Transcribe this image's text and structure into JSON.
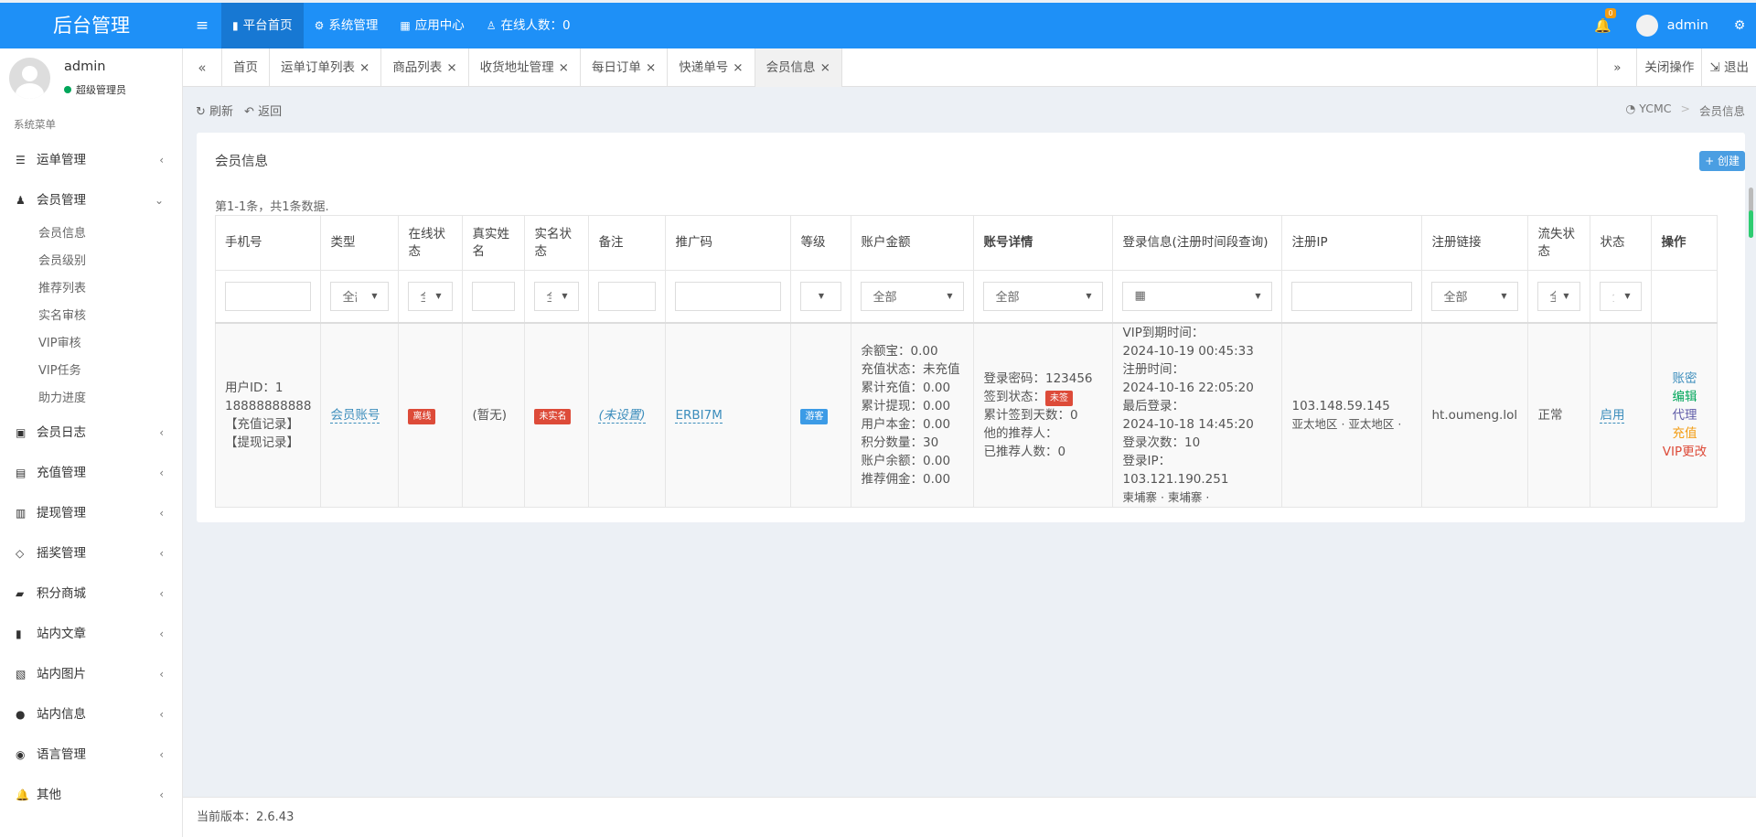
{
  "brand": "后台管理",
  "topnav": [
    {
      "icon": "bookmark-icon",
      "glyph": "❚",
      "label": "平台首页",
      "active": true
    },
    {
      "icon": "gears-icon",
      "glyph": "⚙",
      "label": "系统管理",
      "active": false
    },
    {
      "icon": "grid-icon",
      "glyph": "▦",
      "label": "应用中心",
      "active": false
    },
    {
      "icon": "user-icon",
      "glyph": "♙",
      "label": "在线人数：0",
      "active": false
    }
  ],
  "top_right": {
    "notif_count": "0",
    "username": "admin"
  },
  "sidebar": {
    "user": {
      "name": "admin",
      "role": "超级管理员"
    },
    "header": "系统菜单",
    "menu": [
      {
        "label": "运单管理",
        "icon": "list-icon",
        "glyph": "☰",
        "expanded": false
      },
      {
        "label": "会员管理",
        "icon": "user-icon",
        "glyph": "♟",
        "expanded": true,
        "children": [
          "会员信息",
          "会员级别",
          "推荐列表",
          "实名审核",
          "VIP审核",
          "VIP任务",
          "助力进度"
        ]
      },
      {
        "label": "会员日志",
        "icon": "id-card-icon",
        "glyph": "▣",
        "expanded": false
      },
      {
        "label": "充值管理",
        "icon": "money-icon",
        "glyph": "▤",
        "expanded": false
      },
      {
        "label": "提现管理",
        "icon": "keyboard-icon",
        "glyph": "▥",
        "expanded": false
      },
      {
        "label": "摇奖管理",
        "icon": "diamond-icon",
        "glyph": "◇",
        "expanded": false
      },
      {
        "label": "积分商城",
        "icon": "shopping-bag-icon",
        "glyph": "▰",
        "expanded": false
      },
      {
        "label": "站内文章",
        "icon": "book-icon",
        "glyph": "▮",
        "expanded": false
      },
      {
        "label": "站内图片",
        "icon": "image-icon",
        "glyph": "▧",
        "expanded": false
      },
      {
        "label": "站内信息",
        "icon": "comment-icon",
        "glyph": "●",
        "expanded": false
      },
      {
        "label": "语言管理",
        "icon": "comments-icon",
        "glyph": "◉",
        "expanded": false
      },
      {
        "label": "其他",
        "icon": "bell-icon",
        "glyph": "🔔",
        "expanded": false
      }
    ]
  },
  "tabs": [
    {
      "label": "首页",
      "closable": false,
      "active": false
    },
    {
      "label": "运单订单列表",
      "closable": true,
      "active": false
    },
    {
      "label": "商品列表",
      "closable": true,
      "active": false
    },
    {
      "label": "收货地址管理",
      "closable": true,
      "active": false
    },
    {
      "label": "每日订单",
      "closable": true,
      "active": false
    },
    {
      "label": "快递单号",
      "closable": true,
      "active": false
    },
    {
      "label": "会员信息",
      "closable": true,
      "active": true
    }
  ],
  "tab_actions": {
    "close_ops": "关闭操作",
    "logout": "退出"
  },
  "toolbar": {
    "refresh": "刷新",
    "back": "返回"
  },
  "breadcrumb": [
    "YCMC",
    "会员信息"
  ],
  "panel": {
    "title": "会员信息",
    "create": "创建",
    "summary": "第1-1条，共1条数据."
  },
  "table": {
    "headers": [
      "手机号",
      "类型",
      "在线状态",
      "真实姓名",
      "实名状态",
      "备注",
      "推广码",
      "等级",
      "账户金额",
      "账号详情",
      "登录信息(注册时间段查询)",
      "注册IP",
      "注册链接",
      "流失状态",
      "状态",
      "操作"
    ],
    "filters": {
      "type": "全部",
      "online": "全部",
      "real_status": "全部",
      "level": "",
      "amount": "全部",
      "detail": "全部",
      "source": "全部",
      "lost": "全部",
      "status": "全部"
    },
    "row": {
      "phone_lines": [
        "用户ID：1",
        "18888888888",
        "【充值记录】",
        "【提现记录】"
      ],
      "type": "会员账号",
      "online": "离线",
      "real_name": "(暂无)",
      "real_status": "未实名",
      "remark": "(未设置)",
      "promo": "ERBI7M",
      "level": "游客",
      "amount_lines": [
        "余额宝：0.00",
        "充值状态：未充值",
        "累计充值：0.00",
        "累计提现：0.00",
        "用户本金：0.00",
        "积分数量：30",
        "账户余额：0.00",
        "推荐佣金：0.00"
      ],
      "detail": {
        "pwd": "登录密码：123456",
        "sign_label": "签到状态：",
        "sign_badge": "未签",
        "sign_days": "累计签到天数：0",
        "referrer": "他的推荐人：",
        "referred": "已推荐人数：0"
      },
      "login_lines": [
        "VIP到期时间：",
        "2024-10-19 00:45:33",
        "注册时间：",
        "2024-10-16 22:05:20",
        "最后登录：",
        "2024-10-18 14:45:20",
        "登录次数：10",
        "登录IP：103.121.190.251",
        "柬埔寨 · 柬埔寨 ·"
      ],
      "reg_ip_lines": [
        "103.148.59.145",
        "亚太地区 · 亚太地区 ·"
      ],
      "reg_link": "ht.oumeng.lol",
      "lost": "正常",
      "status": "启用",
      "ops": [
        "账密",
        "编辑",
        "代理",
        "充值",
        "VIP更改"
      ]
    }
  },
  "footer": {
    "version": "当前版本：2.6.43"
  }
}
